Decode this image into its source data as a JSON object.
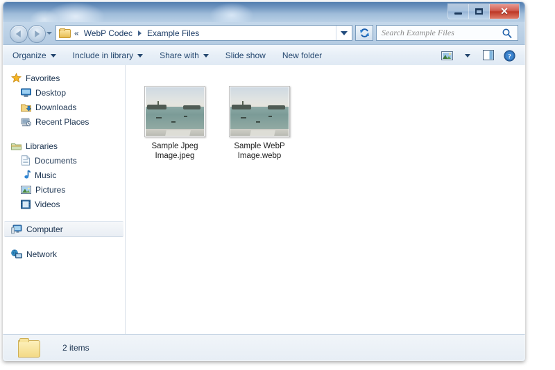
{
  "window": {
    "title": "",
    "controls": {
      "minimize_label": "–",
      "maximize_label": "□",
      "close_label": "✕"
    }
  },
  "address_bar": {
    "root_separator": "«",
    "crumbs": [
      "WebP Codec",
      "Example Files"
    ],
    "folder_icon": "folder-icon",
    "dropdown_icon": "chevron-down-icon",
    "refresh_icon": "refresh-icon"
  },
  "search": {
    "placeholder": "Search Example Files",
    "icon": "search-icon"
  },
  "navigation": {
    "back_icon": "back-arrow-icon",
    "forward_icon": "forward-arrow-icon",
    "history_icon": "chevron-down-icon"
  },
  "toolbar": {
    "items": [
      {
        "label": "Organize",
        "has_caret": true
      },
      {
        "label": "Include in library",
        "has_caret": true
      },
      {
        "label": "Share with",
        "has_caret": true
      },
      {
        "label": "Slide show",
        "has_caret": false
      },
      {
        "label": "New folder",
        "has_caret": false
      }
    ],
    "right_icons": [
      {
        "name": "change-view-icon"
      },
      {
        "name": "change-view-caret-icon"
      },
      {
        "name": "preview-pane-icon"
      },
      {
        "name": "help-icon"
      }
    ]
  },
  "sidebar": {
    "groups": [
      {
        "header": {
          "label": "Favorites",
          "icon": "star-icon"
        },
        "items": [
          {
            "label": "Desktop",
            "icon": "desktop-icon"
          },
          {
            "label": "Downloads",
            "icon": "downloads-icon"
          },
          {
            "label": "Recent Places",
            "icon": "recent-places-icon"
          }
        ]
      },
      {
        "header": {
          "label": "Libraries",
          "icon": "libraries-icon"
        },
        "items": [
          {
            "label": "Documents",
            "icon": "document-icon"
          },
          {
            "label": "Music",
            "icon": "music-icon"
          },
          {
            "label": "Pictures",
            "icon": "pictures-icon"
          },
          {
            "label": "Videos",
            "icon": "videos-icon"
          }
        ]
      },
      {
        "header": {
          "label": "Computer",
          "icon": "computer-icon",
          "selected": true
        },
        "items": []
      },
      {
        "header": {
          "label": "Network",
          "icon": "network-icon"
        },
        "items": []
      }
    ]
  },
  "files": [
    {
      "name_line1": "Sample Jpeg",
      "name_line2": "Image.jpeg",
      "thumbnail": "venice-lagoon-thumbnail"
    },
    {
      "name_line1": "Sample WebP",
      "name_line2": "Image.webp",
      "thumbnail": "venice-lagoon-thumbnail"
    }
  ],
  "status_bar": {
    "folder_icon": "folder-icon",
    "item_count_text": "2 items"
  },
  "colors": {
    "accent_blue": "#24476f",
    "close_red": "#bc3826",
    "frame_blue": "#9bb6d4",
    "link_text": "#1c3c66"
  }
}
